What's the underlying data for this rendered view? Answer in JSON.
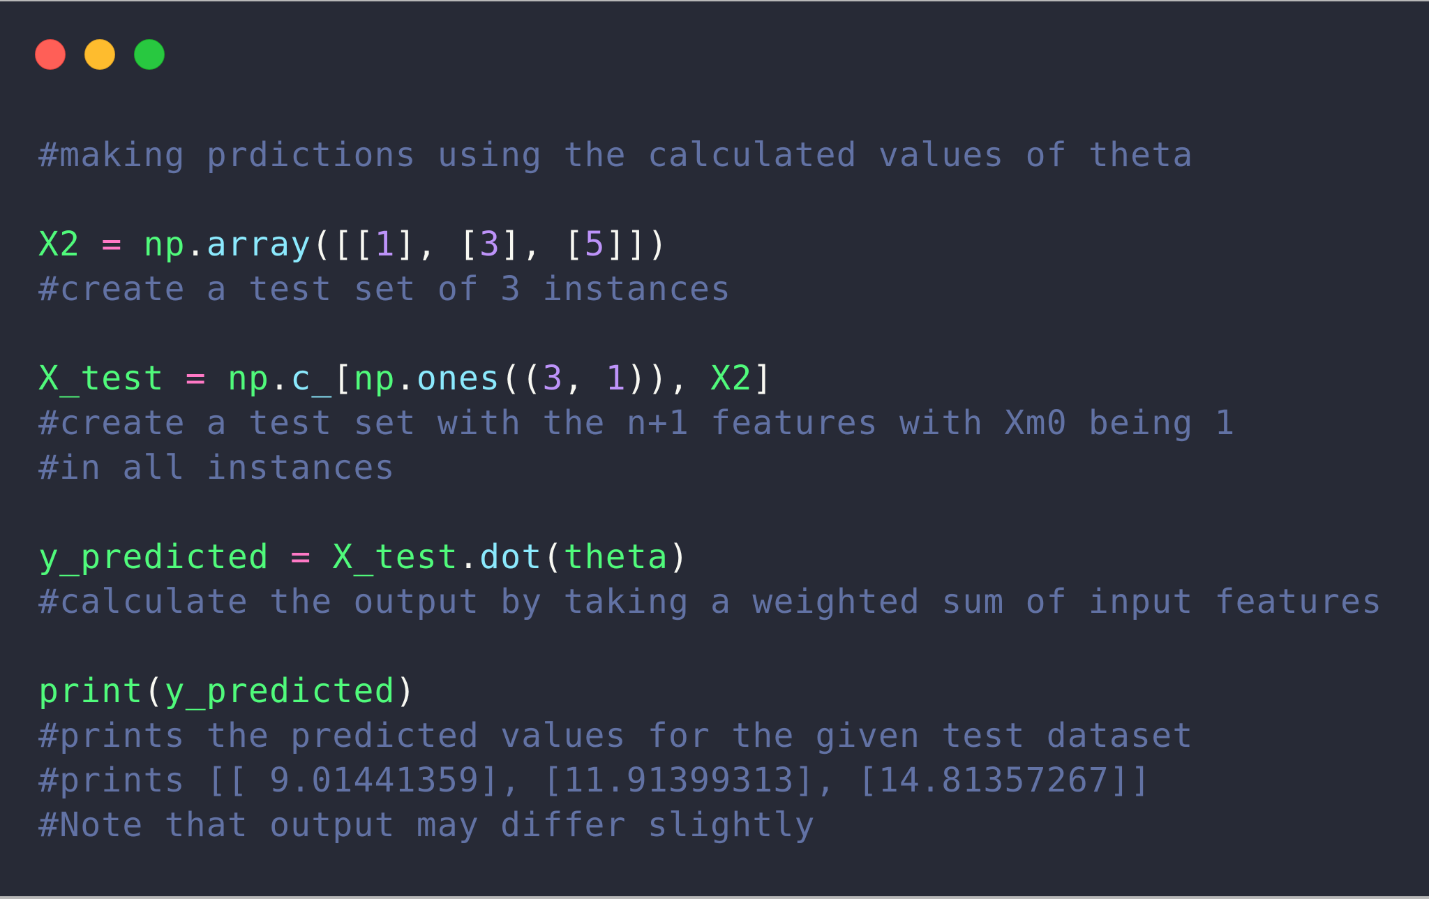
{
  "window": {
    "controls": [
      {
        "name": "close",
        "color": "#ff5f57"
      },
      {
        "name": "minimize",
        "color": "#febc2e"
      },
      {
        "name": "maximize",
        "color": "#28c840"
      }
    ]
  },
  "theme": {
    "background": "#272a36",
    "comment": "#6272a4",
    "identifier": "#50fa7b",
    "operator": "#ff79c6",
    "function": "#8be9fd",
    "number": "#bd93f9",
    "plain": "#f8f8f2"
  },
  "code": {
    "lines": [
      [
        {
          "t": "cm",
          "v": "#making prdictions using the calculated values of theta"
        }
      ],
      [],
      [
        {
          "t": "id",
          "v": "X2"
        },
        {
          "t": "pl",
          "v": " "
        },
        {
          "t": "op",
          "v": "="
        },
        {
          "t": "pl",
          "v": " "
        },
        {
          "t": "id",
          "v": "np"
        },
        {
          "t": "pl",
          "v": "."
        },
        {
          "t": "fn",
          "v": "array"
        },
        {
          "t": "pl",
          "v": "([["
        },
        {
          "t": "num",
          "v": "1"
        },
        {
          "t": "pl",
          "v": "], ["
        },
        {
          "t": "num",
          "v": "3"
        },
        {
          "t": "pl",
          "v": "], ["
        },
        {
          "t": "num",
          "v": "5"
        },
        {
          "t": "pl",
          "v": "]])"
        }
      ],
      [
        {
          "t": "cm",
          "v": "#create a test set of 3 instances"
        }
      ],
      [],
      [
        {
          "t": "id",
          "v": "X_test"
        },
        {
          "t": "pl",
          "v": " "
        },
        {
          "t": "op",
          "v": "="
        },
        {
          "t": "pl",
          "v": " "
        },
        {
          "t": "id",
          "v": "np"
        },
        {
          "t": "pl",
          "v": "."
        },
        {
          "t": "fn",
          "v": "c_"
        },
        {
          "t": "pl",
          "v": "["
        },
        {
          "t": "id",
          "v": "np"
        },
        {
          "t": "pl",
          "v": "."
        },
        {
          "t": "fn",
          "v": "ones"
        },
        {
          "t": "pl",
          "v": "(("
        },
        {
          "t": "num",
          "v": "3"
        },
        {
          "t": "pl",
          "v": ", "
        },
        {
          "t": "num",
          "v": "1"
        },
        {
          "t": "pl",
          "v": ")), "
        },
        {
          "t": "id",
          "v": "X2"
        },
        {
          "t": "pl",
          "v": "]"
        }
      ],
      [
        {
          "t": "cm",
          "v": "#create a test set with the n+1 features with Xm0 being 1"
        }
      ],
      [
        {
          "t": "cm",
          "v": "#in all instances"
        }
      ],
      [],
      [
        {
          "t": "id",
          "v": "y_predicted"
        },
        {
          "t": "pl",
          "v": " "
        },
        {
          "t": "op",
          "v": "="
        },
        {
          "t": "pl",
          "v": " "
        },
        {
          "t": "id",
          "v": "X_test"
        },
        {
          "t": "pl",
          "v": "."
        },
        {
          "t": "fn",
          "v": "dot"
        },
        {
          "t": "pl",
          "v": "("
        },
        {
          "t": "id",
          "v": "theta"
        },
        {
          "t": "pl",
          "v": ")"
        }
      ],
      [
        {
          "t": "cm",
          "v": "#calculate the output by taking a weighted sum of input features"
        }
      ],
      [],
      [
        {
          "t": "id",
          "v": "print"
        },
        {
          "t": "pl",
          "v": "("
        },
        {
          "t": "id",
          "v": "y_predicted"
        },
        {
          "t": "pl",
          "v": ")"
        }
      ],
      [
        {
          "t": "cm",
          "v": "#prints the predicted values for the given test dataset"
        }
      ],
      [
        {
          "t": "cm",
          "v": "#prints [[ 9.01441359], [11.91399313], [14.81357267]]"
        }
      ],
      [
        {
          "t": "cm",
          "v": "#Note that output may differ slightly"
        }
      ]
    ]
  }
}
